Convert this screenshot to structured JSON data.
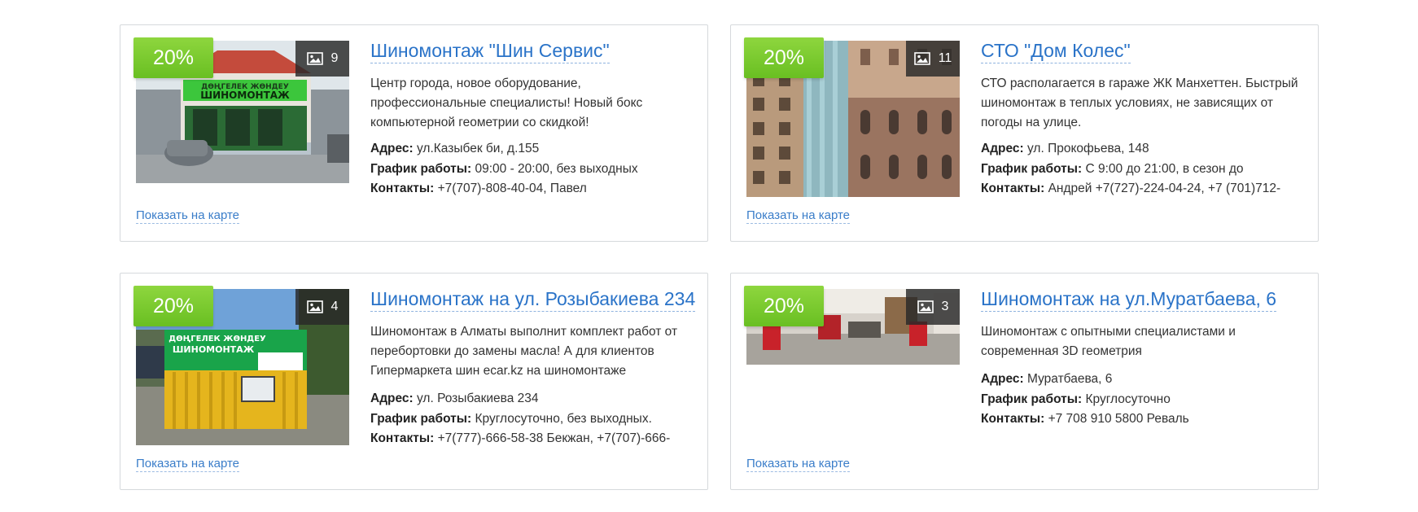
{
  "cards": [
    {
      "discount": "20%",
      "photo_count": "9",
      "title": "Шиномонтаж \"Шин Сервис\"",
      "description": "Центр города, новое оборудование, профессиональные специалисты! Новый бокс компьютерной геометрии со скидкой!",
      "address_label": "Адрес:",
      "address": "ул.Казыбек би, д.155",
      "hours_label": "График работы:",
      "hours": "09:00 - 20:00, без выходных",
      "contacts_label": "Контакты:",
      "contacts": "+7(707)-808-40-04, Павел",
      "map_link": "Показать на карте",
      "photo_sign_line1": "ДӨҢГЕЛЕК ЖӨНДЕУ",
      "photo_sign_line2": "ШИНОМОНТАЖ"
    },
    {
      "discount": "20%",
      "photo_count": "11",
      "title": "СТО \"Дом Колес\"",
      "description": "СТО располагается в гараже ЖК Манхеттен. Быстрый шиномонтаж в теплых условиях, не зависящих от погоды на улице.",
      "address_label": "Адрес:",
      "address": "ул. Прокофьева, 148",
      "hours_label": "График работы:",
      "hours": "С 9:00 до 21:00, в сезон до",
      "contacts_label": "Контакты:",
      "contacts": "Андрей +7(727)-224-04-24, +7 (701)712-",
      "map_link": "Показать на карте"
    },
    {
      "discount": "20%",
      "photo_count": "4",
      "title": "Шиномонтаж на ул. Розыбакиева 234",
      "description": "Шиномонтаж в Алматы выполнит комплект работ от перебортовки до замены масла! А для клиентов Гипермаркета шин ecar.kz на шиномонтаже",
      "address_label": "Адрес:",
      "address": "ул. Розыбакиева 234",
      "hours_label": "График работы:",
      "hours": "Круглосуточно, без выходных.",
      "contacts_label": "Контакты:",
      "contacts": "+7(777)-666-58-38 Бекжан, +7(707)-666-",
      "map_link": "Показать на карте",
      "photo_sign_line1": "ДӨҢГЕЛЕК ЖӨНДЕУ",
      "photo_sign_line2": "ШИНОМОНТАЖ"
    },
    {
      "discount": "20%",
      "photo_count": "3",
      "title": "Шиномонтаж на ул.Муратбаева, 6",
      "description": "Шиномонтаж с опытными специалистами и современная 3D геометрия",
      "address_label": "Адрес:",
      "address": "Муратбаева, 6",
      "hours_label": "График работы:",
      "hours": "Круглосуточно",
      "contacts_label": "Контакты:",
      "contacts": "+7 708 910 5800 Реваль",
      "map_link": "Показать на карте"
    }
  ]
}
